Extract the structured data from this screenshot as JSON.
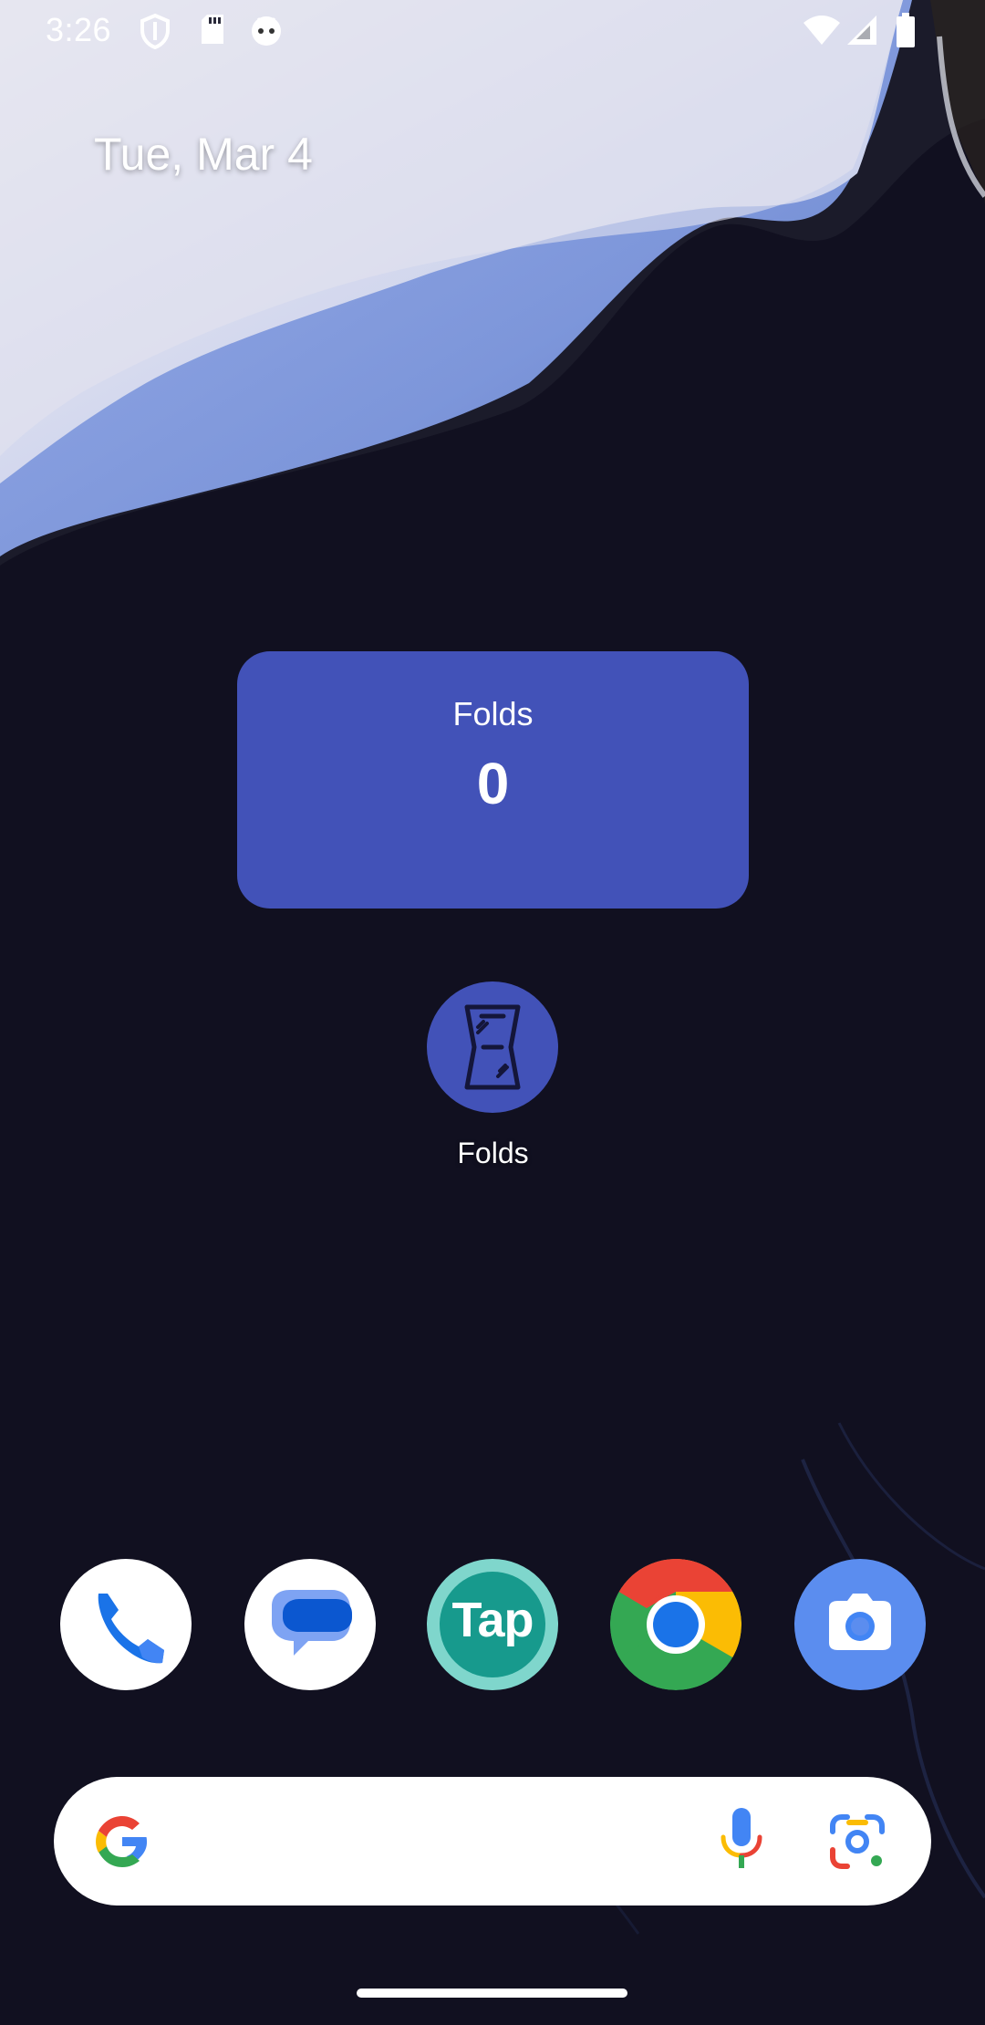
{
  "status_bar": {
    "time": "3:26",
    "left_icons": [
      "shield-icon",
      "sd-card-icon",
      "android-robot-icon"
    ],
    "right_icons": [
      "wifi-icon",
      "cell-signal-icon",
      "battery-icon"
    ]
  },
  "home": {
    "date": "Tue, Mar 4"
  },
  "widget": {
    "title": "Folds",
    "count": "0",
    "color": "#4252b8"
  },
  "apps": [
    {
      "label": "Folds",
      "icon": "folds-app-icon"
    }
  ],
  "dock": {
    "items": [
      {
        "name": "phone-app-icon"
      },
      {
        "name": "messages-app-icon"
      },
      {
        "name": "tap-app-icon",
        "text": "Tap"
      },
      {
        "name": "chrome-app-icon"
      },
      {
        "name": "camera-app-icon"
      }
    ]
  },
  "search_bar": {
    "icons": [
      "google-logo-icon",
      "microphone-icon",
      "google-lens-icon"
    ]
  }
}
